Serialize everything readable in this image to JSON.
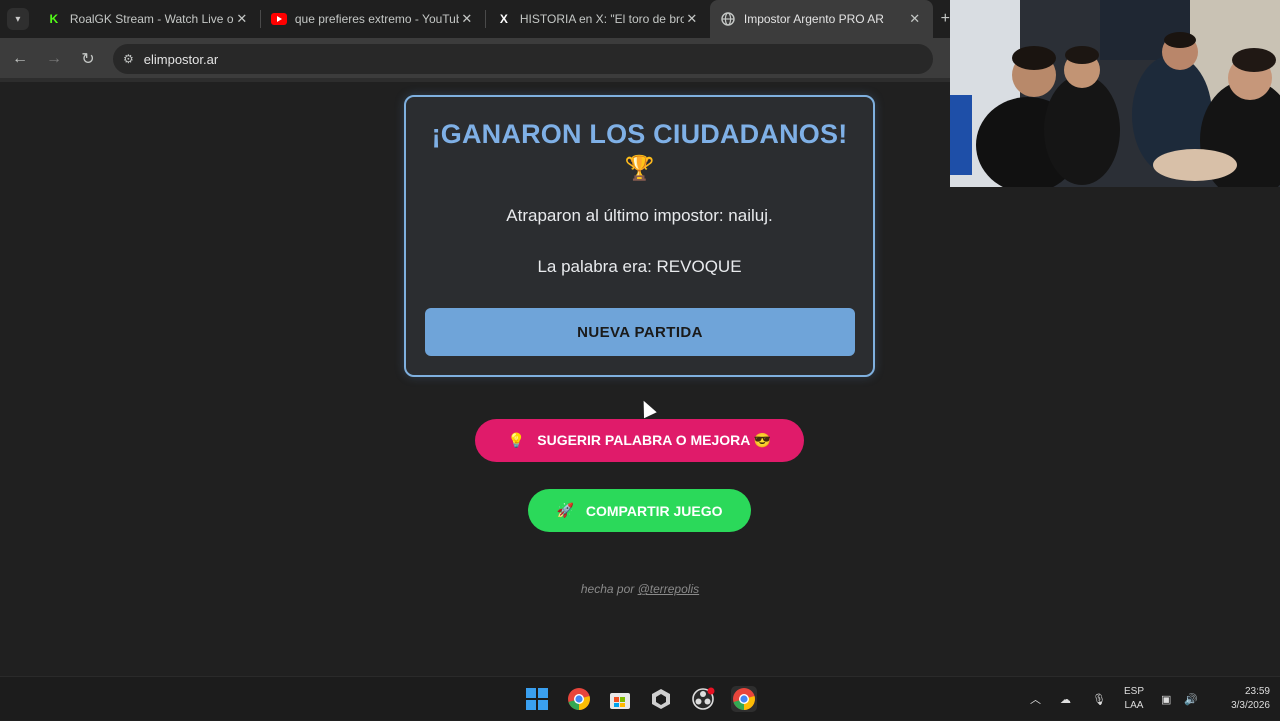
{
  "browser": {
    "tabs": [
      {
        "title": "RoalGK Stream - Watch Live on",
        "favicon": "kick-icon",
        "color": "#53fc18"
      },
      {
        "title": "que prefieres extremo - YouTub",
        "favicon": "youtube-icon",
        "color": "#ff0000"
      },
      {
        "title": "HISTORIA en X: \"El toro de bron",
        "favicon": "x-icon",
        "color": "#ffffff"
      },
      {
        "title": "Impostor Argento PRO AR",
        "favicon": "globe-icon",
        "color": "#c4c7c5",
        "active": true
      }
    ],
    "url": "elimpostor.ar"
  },
  "result": {
    "title": "¡GANARON LOS CIUDADANOS!",
    "trophy": "🏆",
    "caught_text": "Atraparon al último impostor: nailuj.",
    "word_text": "La palabra era: REVOQUE",
    "new_game_label": "NUEVA PARTIDA"
  },
  "actions": {
    "suggest_icon": "💡",
    "suggest_label": "SUGERIR PALABRA O MEJORA",
    "suggest_emoji": "😎",
    "share_icon": "🚀",
    "share_label": "COMPARTIR JUEGO"
  },
  "footer": {
    "prefix": "hecha por",
    "handle": "@terrepolis"
  },
  "taskbar": {
    "lang_top": "ESP",
    "lang_bottom": "LAA",
    "time": "23:59",
    "date": "3/3/2026"
  },
  "colors": {
    "title": "#7fb0e6",
    "new_game": "#6fa4d9",
    "suggest": "#e01b6a",
    "share": "#2bd95a"
  }
}
